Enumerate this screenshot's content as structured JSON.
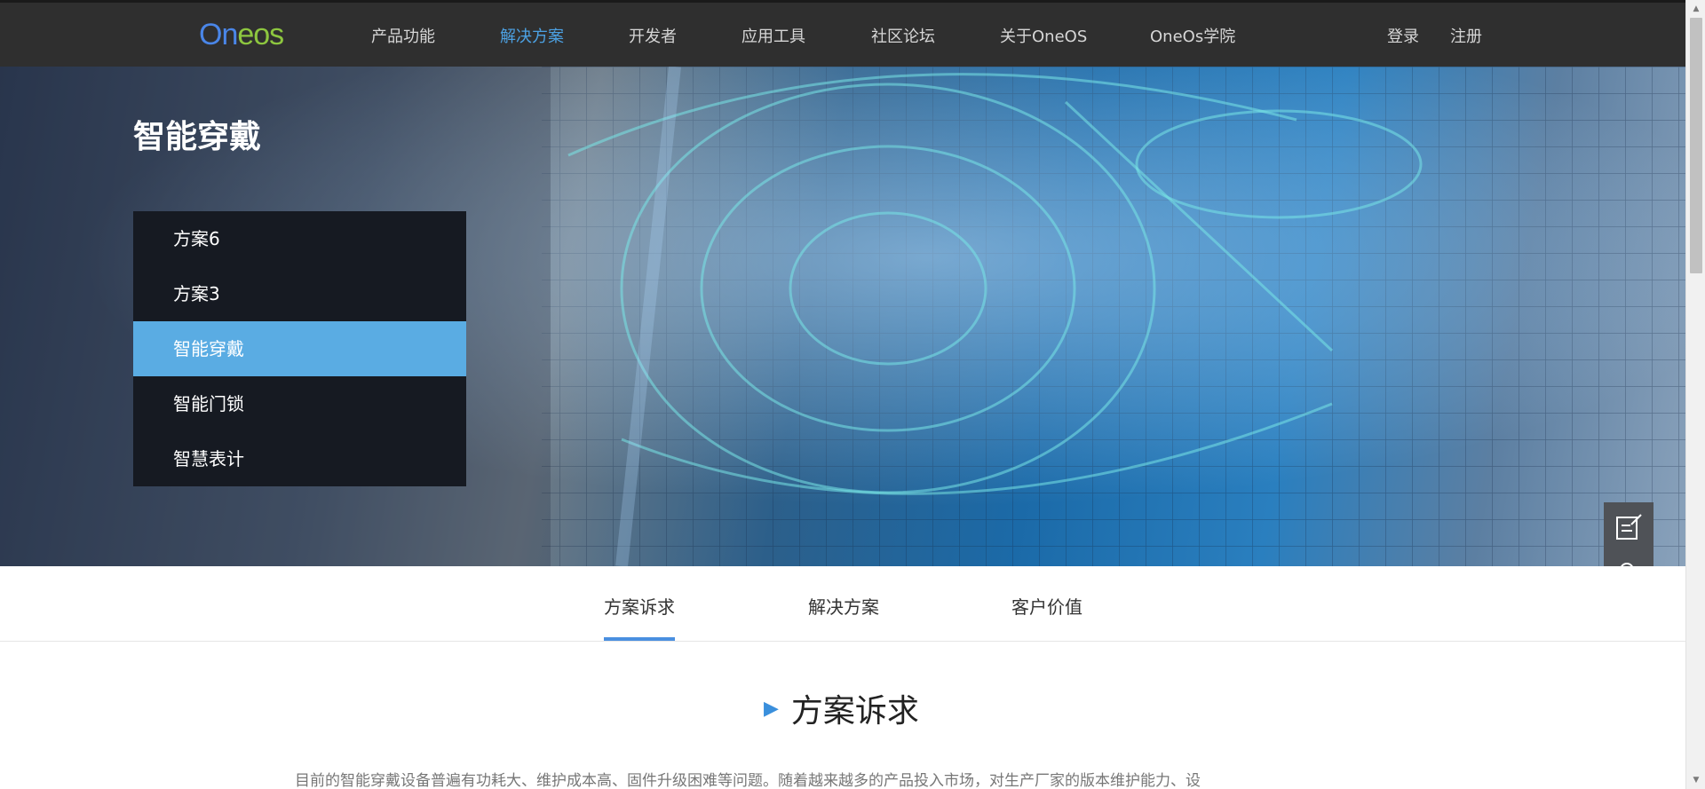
{
  "header": {
    "logo": {
      "part1": "On",
      "part2": "eos"
    },
    "nav": [
      {
        "label": "产品功能",
        "active": false
      },
      {
        "label": "解决方案",
        "active": true
      },
      {
        "label": "开发者",
        "active": false
      },
      {
        "label": "应用工具",
        "active": false
      },
      {
        "label": "社区论坛",
        "active": false
      },
      {
        "label": "关于OneOS",
        "active": false
      },
      {
        "label": "OneOs学院",
        "active": false
      }
    ],
    "login": "登录",
    "register": "注册"
  },
  "hero": {
    "title": "智能穿戴",
    "menu": [
      {
        "label": "方案6",
        "active": false
      },
      {
        "label": "方案3",
        "active": false
      },
      {
        "label": "智能穿戴",
        "active": true
      },
      {
        "label": "智能门锁",
        "active": false
      },
      {
        "label": "智慧表计",
        "active": false
      }
    ]
  },
  "float_tools": [
    "edit-icon",
    "add-user-icon"
  ],
  "tabs": [
    {
      "label": "方案诉求",
      "active": true
    },
    {
      "label": "解决方案",
      "active": false
    },
    {
      "label": "客户价值",
      "active": false
    }
  ],
  "section": {
    "title": "方案诉求",
    "body": "目前的智能穿戴设备普遍有功耗大、维护成本高、固件升级困难等问题。随着越来越多的产品投入市场，对生产厂家的版本维护能力、设"
  },
  "colors": {
    "nav_bg": "#2f2f2f",
    "accent": "#4ca1e3",
    "menu_active": "#5aace3",
    "tab_underline": "#4a8fe0",
    "logo_blue": "#4a86e8",
    "logo_green": "#8dc63f"
  }
}
